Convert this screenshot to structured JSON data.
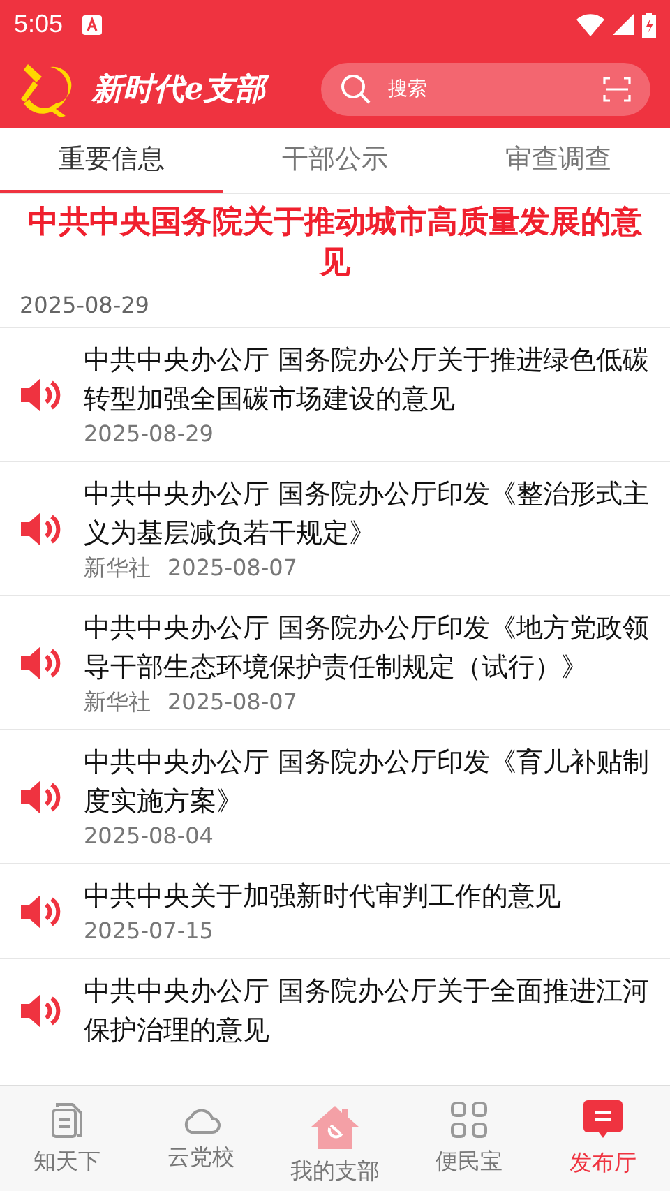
{
  "status_bar": {
    "time": "5:05"
  },
  "header": {
    "app_name": "新时代e支部",
    "search": {
      "placeholder": "搜索"
    }
  },
  "tabs": [
    {
      "label": "重要信息",
      "selected": true
    },
    {
      "label": "干部公示",
      "selected": false
    },
    {
      "label": "审查调查",
      "selected": false
    }
  ],
  "headline": {
    "title": "中共中央国务院关于推动城市高质量发展的意见",
    "date": "2025-08-29"
  },
  "articles": [
    {
      "title": "中共中央办公厅 国务院办公厅关于推进绿色低碳转型加强全国碳市场建设的意见",
      "date": "2025-08-29"
    },
    {
      "title": "中共中央办公厅 国务院办公厅印发《整治形式主义为基层减负若干规定》",
      "source": "新华社",
      "date": "2025-08-07"
    },
    {
      "title": "中共中央办公厅 国务院办公厅印发《地方党政领导干部生态环境保护责任制规定（试行）》",
      "source": "新华社",
      "date": "2025-08-07"
    },
    {
      "title": "中共中央办公厅 国务院办公厅印发《育儿补贴制度实施方案》",
      "date": "2025-08-04"
    },
    {
      "title": "中共中央关于加强新时代审判工作的意见",
      "date": "2025-07-15"
    },
    {
      "title": "中共中央办公厅 国务院办公厅关于全面推进江河保护治理的意见"
    }
  ],
  "bottom_nav": [
    {
      "label": "知天下",
      "kind": "docs",
      "selected": false
    },
    {
      "label": "云党校",
      "kind": "cloud",
      "selected": false
    },
    {
      "label": "我的支部",
      "kind": "home",
      "selected": false
    },
    {
      "label": "便民宝",
      "kind": "grid",
      "selected": false
    },
    {
      "label": "发布厅",
      "kind": "chat",
      "selected": true
    }
  ]
}
